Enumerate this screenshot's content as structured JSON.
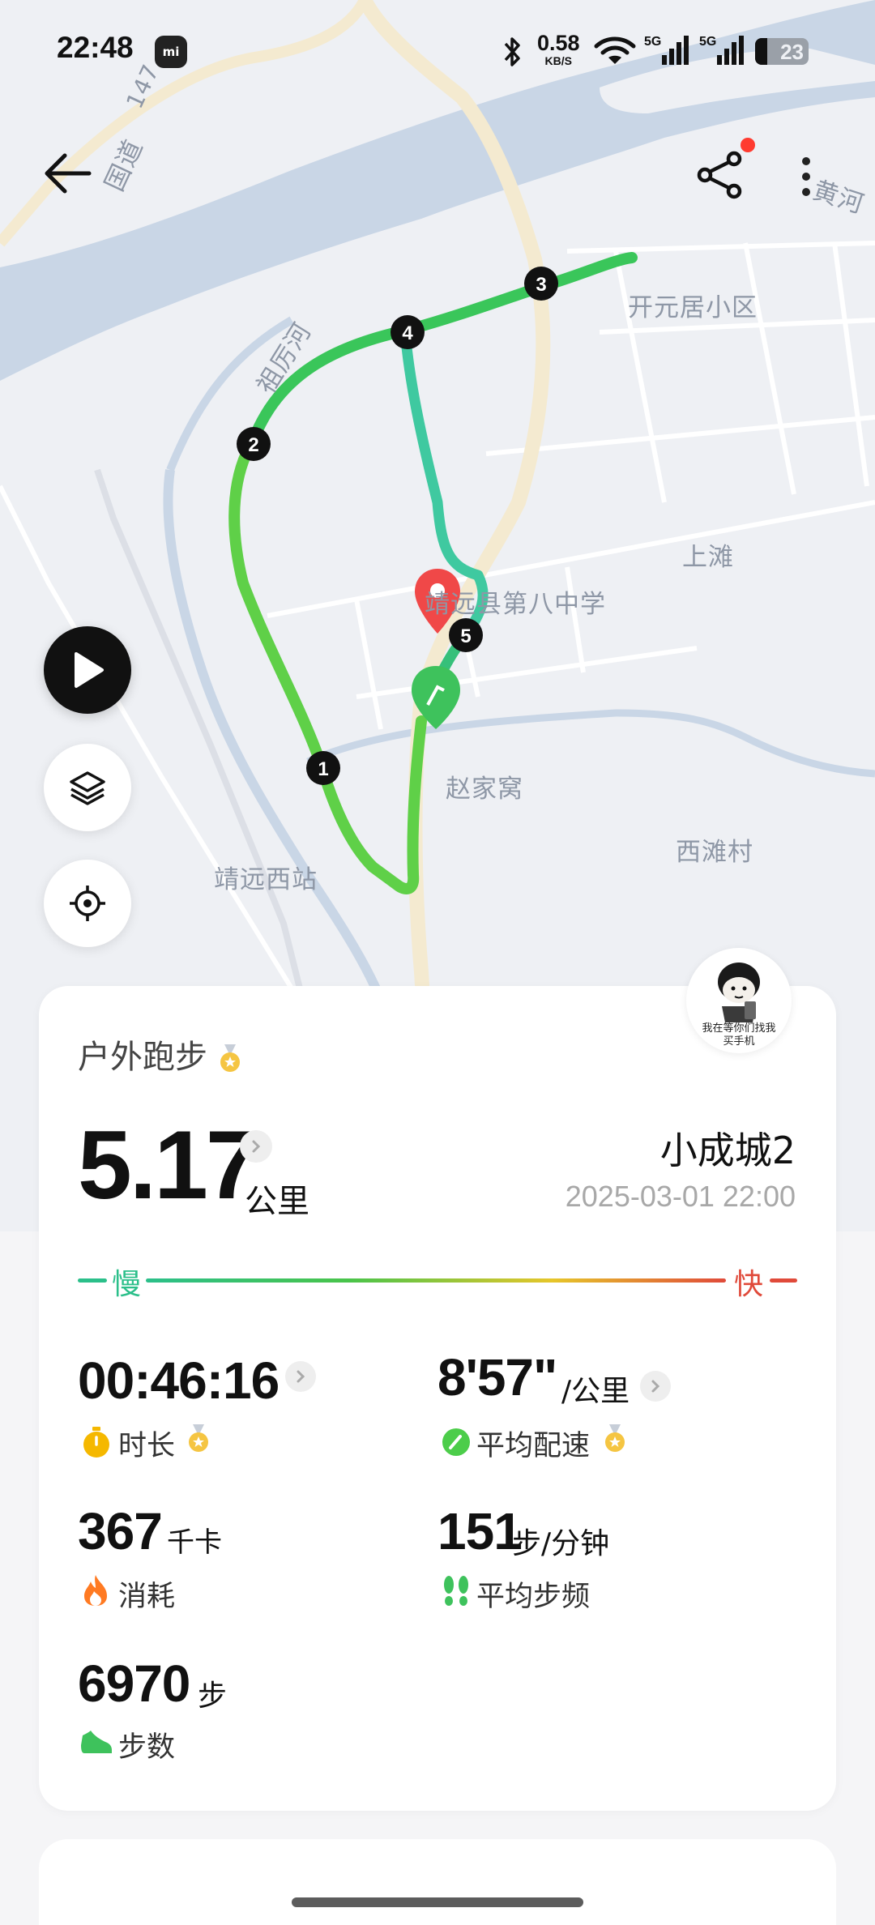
{
  "status_bar": {
    "time": "22:48",
    "app_badge": "mi",
    "net_speed_value": "0.58",
    "net_speed_unit": "KB/S",
    "signal1_label": "5G",
    "signal2_label": "5G",
    "battery_level": "23"
  },
  "map": {
    "labels": {
      "road_g": "国道",
      "road_147": "147",
      "river": "祖厉河",
      "yellow_river": "黄河",
      "area_kaiyuan": "开元居小区",
      "area_shangtan": "上滩",
      "school": "靖远县第八中学",
      "village_zhao": "赵家窝",
      "village_xitan": "西滩村",
      "station": "靖远西站"
    },
    "km_markers": [
      "1",
      "2",
      "3",
      "4",
      "5"
    ]
  },
  "icons": {
    "back": "back-arrow-icon",
    "share": "share-icon",
    "more": "more-vertical-icon",
    "play": "play-icon",
    "layers": "layers-icon",
    "locate": "locate-icon"
  },
  "profile": {
    "avatar_caption_line1": "我在等你们找我",
    "avatar_caption_line2": "买手机"
  },
  "workout": {
    "type": "户外跑步",
    "distance": "5.17",
    "distance_unit": "公里",
    "location": "小成城2",
    "datetime": "2025-03-01 22:00",
    "pace_legend_slow": "慢",
    "pace_legend_fast": "快"
  },
  "stats": {
    "duration": {
      "value": "00:46:16",
      "label": "时长"
    },
    "avg_pace": {
      "value": "8'57\"",
      "unit": "/公里",
      "label": "平均配速"
    },
    "calories": {
      "value": "367",
      "unit": "千卡",
      "label": "消耗"
    },
    "cadence": {
      "value": "151",
      "unit": "步/分钟",
      "label": "平均步频"
    },
    "steps": {
      "value": "6970",
      "unit": "步",
      "label": "步数"
    }
  },
  "colors": {
    "pace_slow": "#2bbf8a",
    "pace_fast": "#e04a3a",
    "route_green": "#4ccd4a",
    "pin_red": "#f04848"
  }
}
